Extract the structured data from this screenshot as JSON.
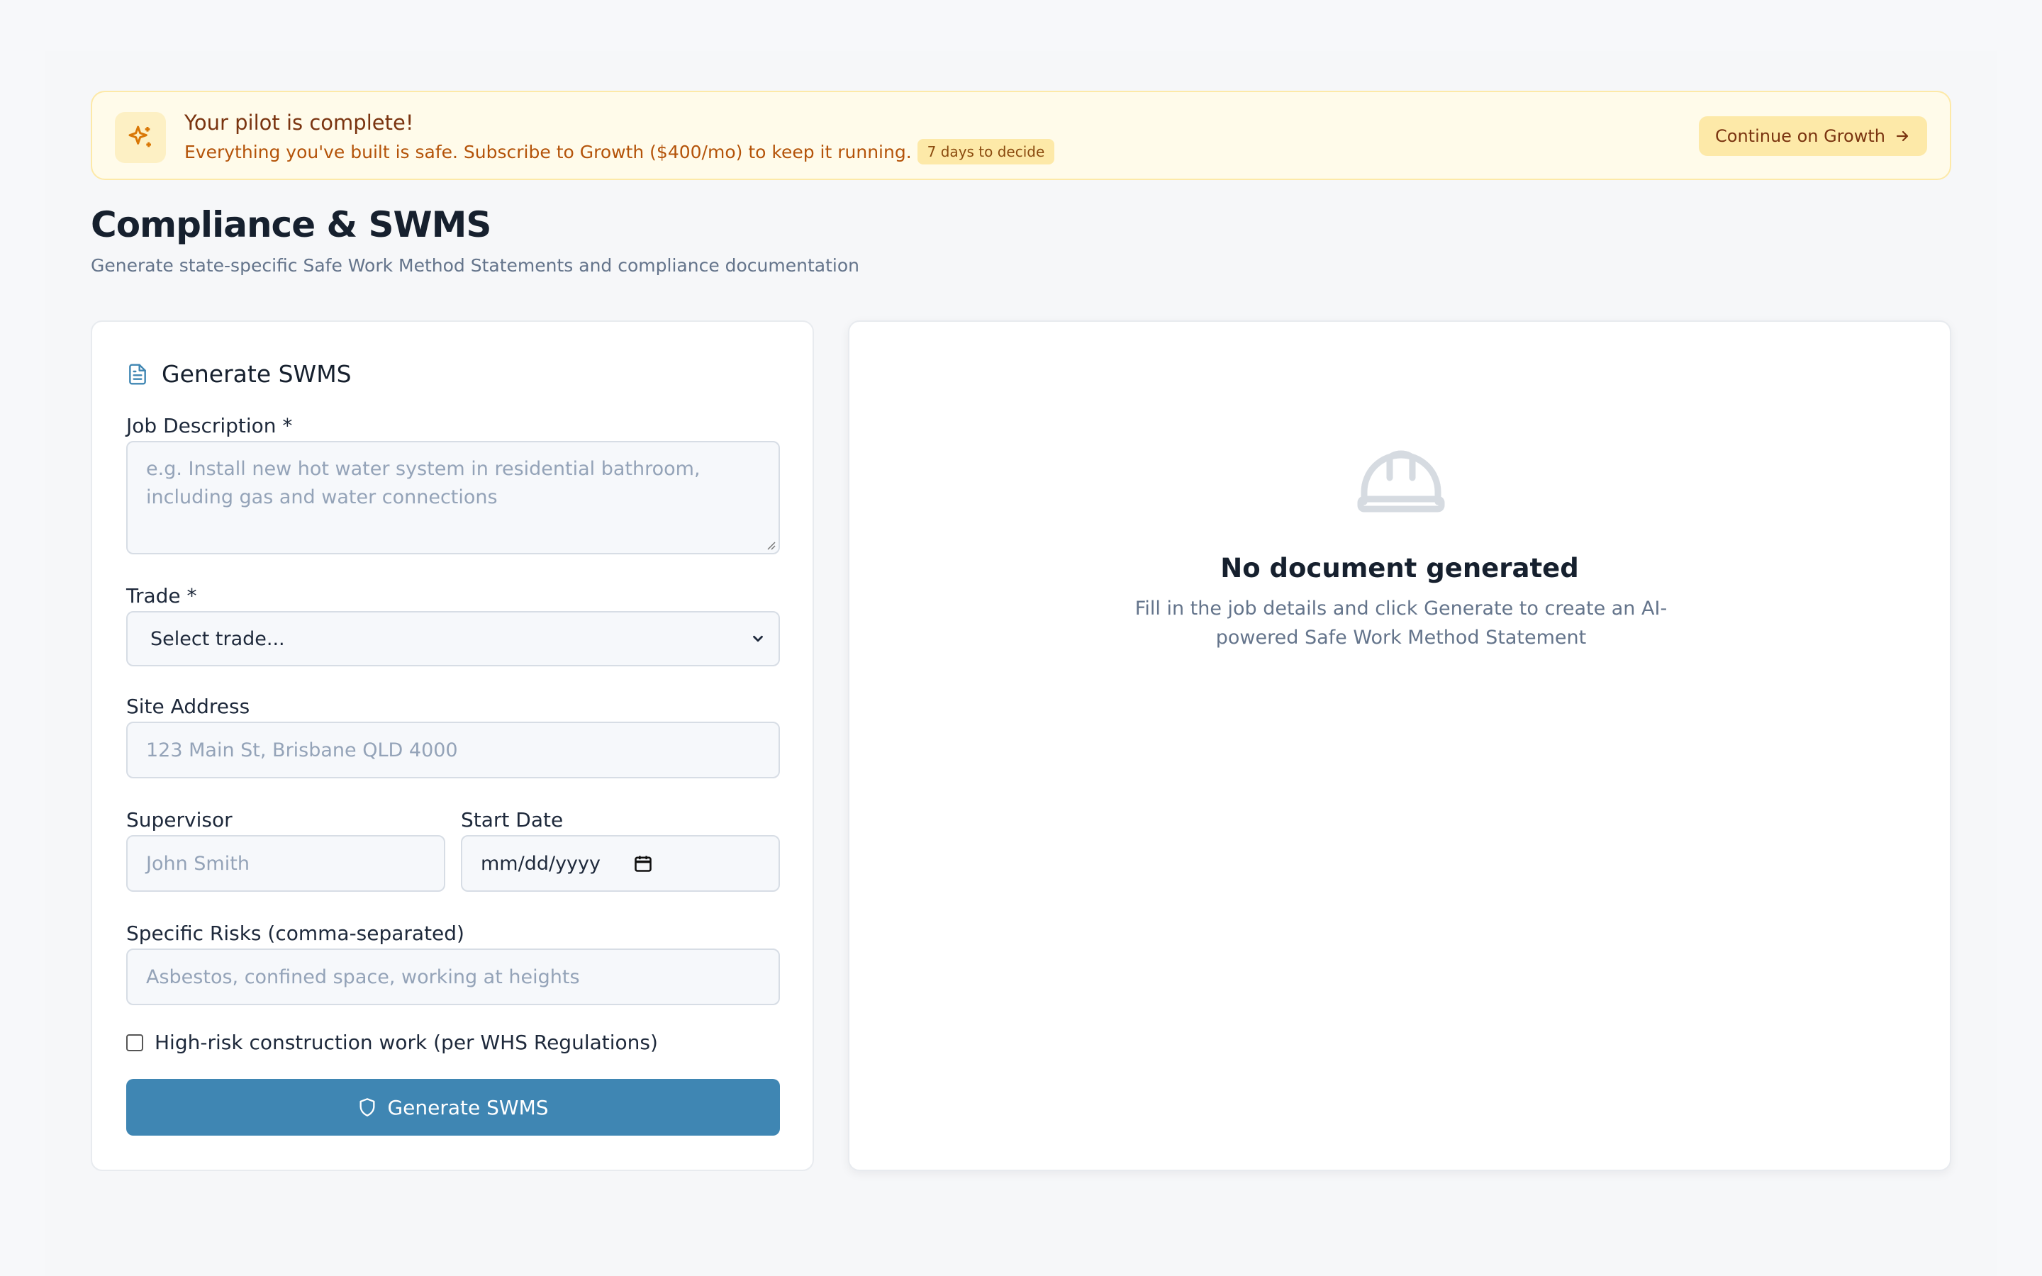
{
  "banner": {
    "title": "Your pilot is complete!",
    "message": "Everything you've built is safe. Subscribe to Growth ($400/mo) to keep it running.",
    "badge": "7 days to decide",
    "cta_label": "Continue on Growth",
    "icon": "sparkles-icon"
  },
  "header": {
    "title": "Compliance & SWMS",
    "subtitle": "Generate state-specific Safe Work Method Statements and compliance documentation"
  },
  "form": {
    "title": "Generate SWMS",
    "job_description": {
      "label": "Job Description *",
      "value": "",
      "placeholder_line1": "e.g. Install new hot water system in residential bathroom,",
      "placeholder_line2": "including gas and water connections"
    },
    "trade": {
      "label": "Trade *",
      "selected": "Select trade..."
    },
    "site_address": {
      "label": "Site Address",
      "value": "",
      "placeholder": "123 Main St, Brisbane QLD 4000"
    },
    "supervisor": {
      "label": "Supervisor",
      "value": "",
      "placeholder": "John Smith"
    },
    "start_date": {
      "label": "Start Date",
      "value": "mm/dd/yyyy"
    },
    "risks": {
      "label": "Specific Risks (comma-separated)",
      "value": "",
      "placeholder": "Asbestos, confined space, working at heights"
    },
    "high_risk": {
      "label": "High-risk construction work (per WHS Regulations)",
      "checked": false
    },
    "submit_label": "Generate SWMS"
  },
  "preview": {
    "icon": "hard-hat-icon",
    "title": "No document generated",
    "message": "Fill in the job details and click Generate to create an AI-powered Safe Work Method Statement"
  },
  "colors": {
    "accent": "#3f86b3",
    "banner_bg": "#fffbea",
    "banner_text": "#b45309"
  }
}
